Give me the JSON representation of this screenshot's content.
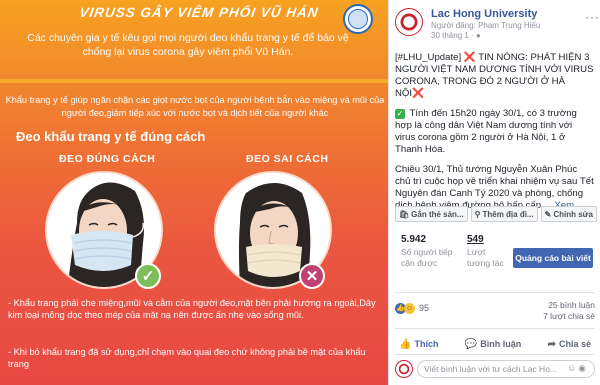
{
  "poster": {
    "title": "VIRUSS GÂY VIÊM PHỔI VŨ HÁN",
    "subtitle": "Các chuyên gia y tế kêu gọi mọi người đeo khẩu trang y tế để bảo vệ chống lại virus corona gây viêm phổi Vũ Hán.",
    "intro": "Khẩu trang y tế giúp ngăn chặn các giọt nước bọt của người bệnh bắn vào miệng và mũi của người đeo,giảm tiếp xúc với nước bọt và dịch tiết của người khác",
    "section_title": "Đeo khẩu trang y tế đúng cách",
    "correct_label": "ĐEO ĐÚNG CÁCH",
    "wrong_label": "ĐEO SAI CÁCH",
    "note1": "- Khẩu trang phải che miệng,mũi và cằm của người đeo,mặt bên phải hướng ra ngoài,Dây kim loại mỏng dọc theo mép của mặt nạ nên được ấn nhẹ vào sống mũi.",
    "note2": "- Khi bỏ khẩu trang đã sử dụng,chỉ chạm vào quai đeo chứ không phải bề mặt của khẩu trang",
    "check_glyph": "✓",
    "cross_glyph": "✕"
  },
  "post": {
    "page_name": "Lac Hong University",
    "posted_by": "Người đăng: Phạm Trung Hiếu",
    "time": "30 tháng 1 · ",
    "para1_lead": "[#LHU_Update] ",
    "para1_x": "❌",
    "para1_text": " TIN NÓNG: PHÁT HIỆN 3 NGƯỜI VIỆT NAM DƯƠNG TÍNH VỚI VIRUS CORONA, TRONG ĐÓ 2 NGƯỜI Ở HÀ NỘI",
    "para1_x2": "❌",
    "para2_check": "✓",
    "para2_text": " Tính đến 15h20 ngày 30/1, có 3 trường hợp là công dân Việt Nam dương tính với virus corona gồm 2 người ở Hà Nội, 1 ở Thanh Hóa.",
    "para3_text": "Chiều 30/1, Thủ tướng Nguyễn Xuân Phúc chủ trì cuộc họp về triển khai nhiệm vụ sau Tết Nguyên đán Canh Tý 2020 và phòng, chống dịch bệnh viêm đường hô hấp cấp ... ",
    "see_more": "Xem thêm",
    "actions": [
      "Gắn thẻ sản...",
      "Thêm địa đi...",
      "Chỉnh sửa"
    ],
    "reach_num": "5.942",
    "reach_desc": "Số người tiếp cận được",
    "engage_num": "549",
    "engage_desc": "Lượt tương tác",
    "boost_label": "Quảng cáo bài viết",
    "react_count": "95",
    "comments": "25 bình luận",
    "shares": "7 lượt chia sẻ",
    "like_label": "Thích",
    "comment_label": "Bình luận",
    "share_label": "Chia sẻ",
    "comment_placeholder": "Viết bình luận với tư cách Lac Ho..."
  }
}
